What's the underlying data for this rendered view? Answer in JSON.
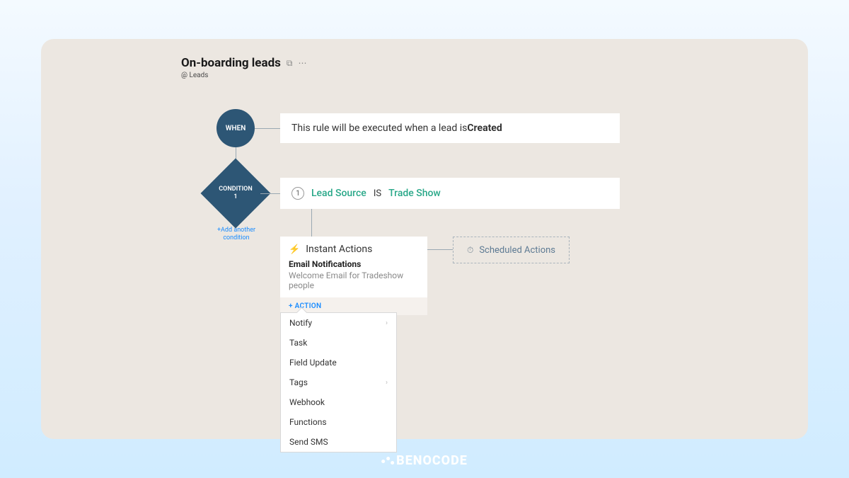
{
  "header": {
    "title": "On-boarding leads",
    "subtitle": "@ Leads"
  },
  "when": {
    "label": "WHEN",
    "text_prefix": "This rule will be executed when a lead is ",
    "text_bold": "Created"
  },
  "condition": {
    "label_top": "CONDITION",
    "label_num": "1",
    "step_num": "1",
    "field": "Lead Source",
    "operator": "IS",
    "value": "Trade Show",
    "add_link": "+Add another condition"
  },
  "instant_actions": {
    "title": "Instant Actions",
    "sub": "Email Notifications",
    "desc": "Welcome Email for Tradeshow people",
    "footer": "+ ACTION"
  },
  "scheduled_actions": {
    "title": "Scheduled Actions"
  },
  "dropdown": {
    "items": [
      {
        "label": "Notify",
        "submenu": true
      },
      {
        "label": "Task",
        "submenu": false
      },
      {
        "label": "Field Update",
        "submenu": false
      },
      {
        "label": "Tags",
        "submenu": true
      },
      {
        "label": "Webhook",
        "submenu": false
      },
      {
        "label": "Functions",
        "submenu": false
      },
      {
        "label": "Send SMS",
        "submenu": false
      }
    ]
  },
  "footer": {
    "brand": "BENOCODE"
  }
}
